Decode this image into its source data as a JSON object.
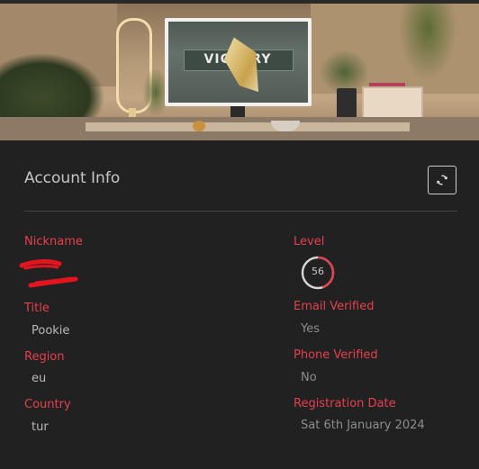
{
  "banner": {
    "monitor_text": "VICTORY"
  },
  "account": {
    "title": "Account Info"
  },
  "fields_left": [
    {
      "label": "Nickname",
      "value": ""
    },
    {
      "label": "Title",
      "value": "Pookie"
    },
    {
      "label": "Region",
      "value": "eu"
    },
    {
      "label": "Country",
      "value": "tur"
    }
  ],
  "fields_right": {
    "level": {
      "label": "Level",
      "value": "56",
      "progress": 0.45
    },
    "email": {
      "label": "Email Verified",
      "value": "Yes"
    },
    "phone": {
      "label": "Phone Verified",
      "value": "No"
    },
    "registration": {
      "label": "Registration Date",
      "value": "Sat 6th January 2024"
    }
  },
  "colors": {
    "accent": "#e4404e",
    "background": "#222122",
    "text": "#b9b8b8"
  },
  "icons": {
    "refresh": "refresh-icon"
  }
}
